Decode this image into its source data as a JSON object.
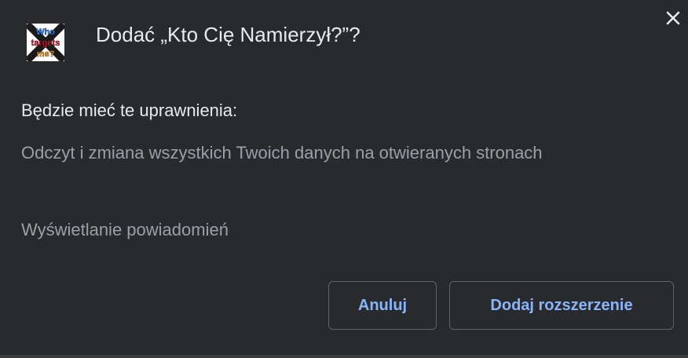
{
  "dialog": {
    "title": "Dodać „Kto Cię Namierzył?”?",
    "subheading": "Będzie mieć te uprawnienia:",
    "permissions": [
      "Odczyt i zmiana wszystkich Twoich danych na otwieranych stronach",
      "Wyświetlanie powiadomień"
    ],
    "buttons": {
      "cancel_label": "Anuluj",
      "add_label": "Dodaj rozszerzenie"
    },
    "extension_icon": {
      "name": "extension-logo-icon",
      "text_lines": [
        "Who",
        "targets",
        "me?"
      ]
    },
    "close_icon": "close-icon"
  },
  "colors": {
    "background": "#292a2d",
    "text_primary": "#e8eaed",
    "text_secondary": "#9aa0a6",
    "accent": "#8ab4f8",
    "button_border": "#5f6368"
  }
}
